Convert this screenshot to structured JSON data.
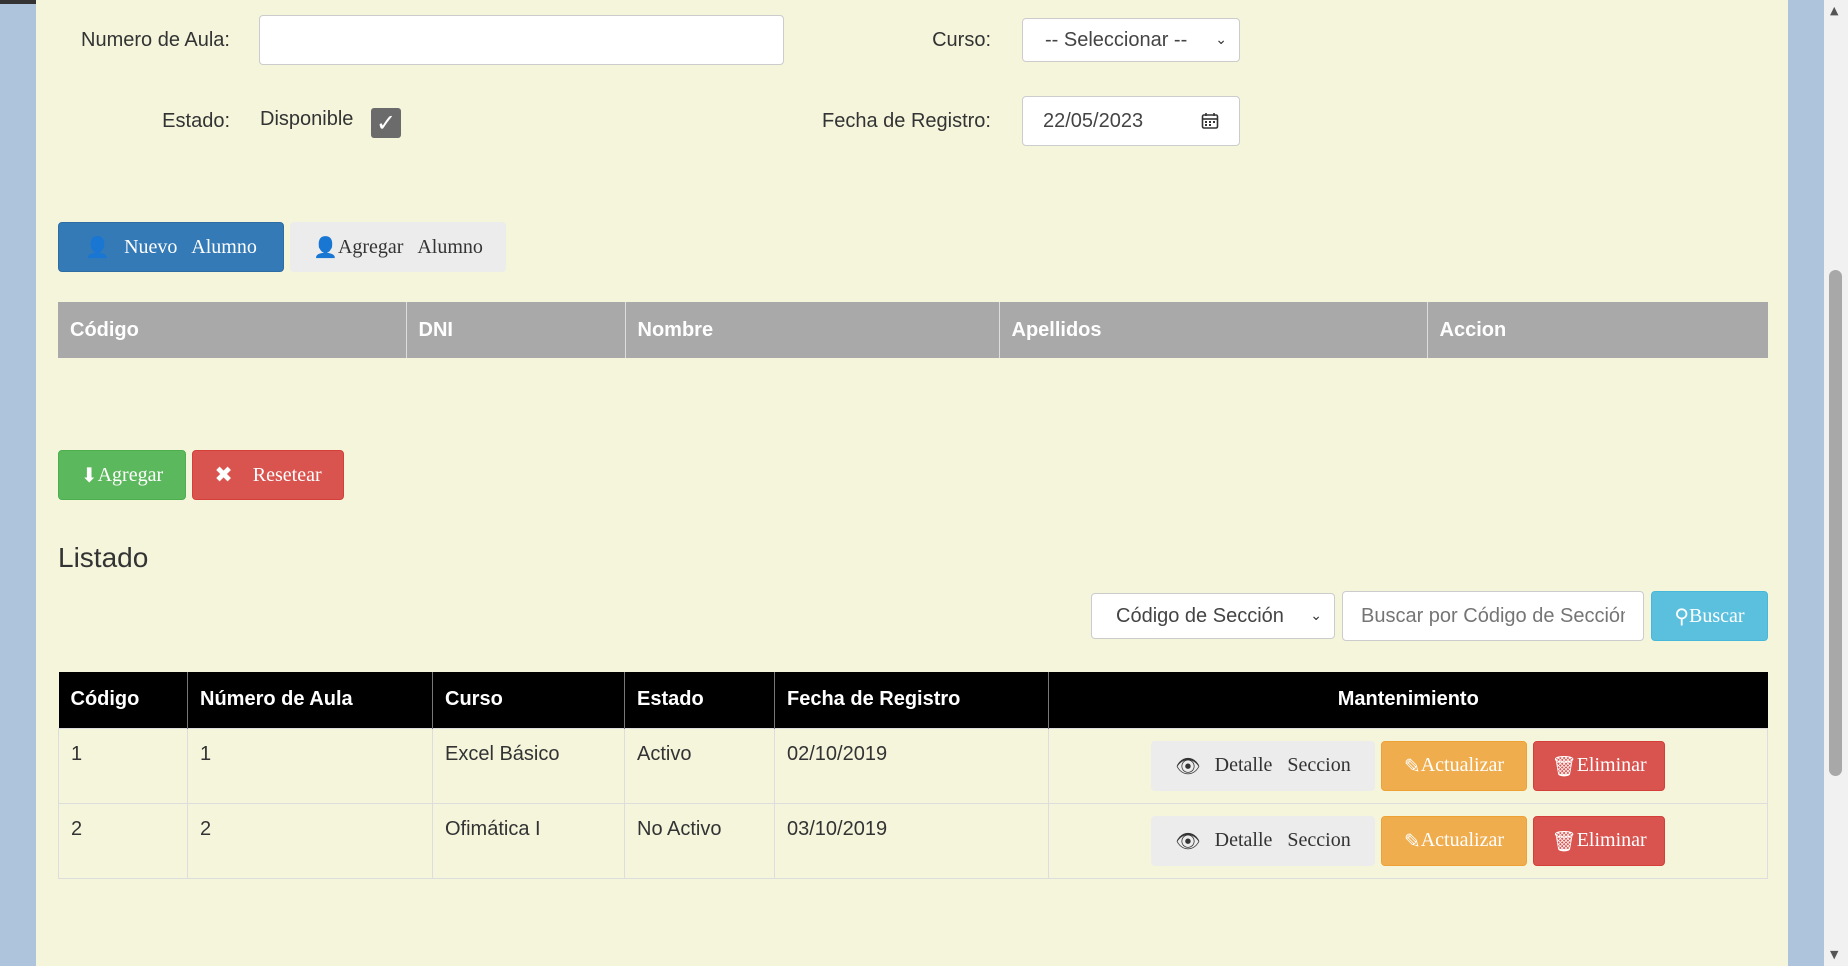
{
  "form": {
    "aula_label": "Numero de Aula:",
    "aula_value": "",
    "curso_label": "Curso:",
    "curso_selected": "-- Seleccionar --",
    "estado_label": "Estado:",
    "estado_text": "Disponible",
    "estado_checked": true,
    "fecha_label": "Fecha de Registro:",
    "fecha_value": "22/05/2023"
  },
  "alumno_buttons": {
    "nuevo": "Nuevo   Alumno",
    "agregar": "Agregar   Alumno"
  },
  "alumnos_table": {
    "headers": [
      "Código",
      "DNI",
      "Nombre",
      "Apellidos",
      "Accion"
    ]
  },
  "actions": {
    "agregar": "Agregar",
    "resetear": "Resetear"
  },
  "listado": {
    "title": "Listado",
    "filter_selected": "Código de Sección",
    "search_placeholder": "Buscar por Código de Sección",
    "search_button": "Buscar"
  },
  "secciones_table": {
    "headers": [
      "Código",
      "Número de Aula",
      "Curso",
      "Estado",
      "Fecha de Registro",
      "Mantenimiento"
    ],
    "rows": [
      {
        "codigo": "1",
        "aula": "1",
        "curso": "Excel Básico",
        "estado": "Activo",
        "fecha": "02/10/2019"
      },
      {
        "codigo": "2",
        "aula": "2",
        "curso": "Ofimática I",
        "estado": "No Activo",
        "fecha": "03/10/2019"
      }
    ],
    "detalle_label": "Detalle   Seccion",
    "actualizar_label": "Actualizar",
    "eliminar_label": "Eliminar"
  },
  "icons": {
    "user": "user-icon",
    "download": "download-icon",
    "close": "close-icon",
    "search": "search-icon",
    "eye": "eye-icon",
    "edit": "edit-icon",
    "trash": "trash-icon",
    "calendar": "calendar-icon",
    "check": "check-icon"
  },
  "colors": {
    "page_bg": "#f5f5dc",
    "primary": "#337ab7",
    "success": "#5cb85c",
    "danger": "#d9534f",
    "info": "#5bc0de",
    "warning": "#f0ad4e"
  }
}
